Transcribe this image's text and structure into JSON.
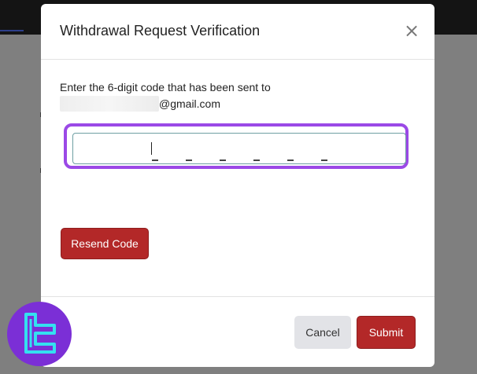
{
  "modal": {
    "title": "Withdrawal Request Verification",
    "close_label": "×",
    "instruction_text": "Enter the 6-digit code that has been sent to",
    "email_domain": "@gmail.com",
    "code_length": 6,
    "code_value": "",
    "resend_label": "Resend Code",
    "cancel_label": "Cancel",
    "submit_label": "Submit"
  },
  "colors": {
    "primary_red": "#b32828",
    "highlight_purple": "#9b49e6",
    "cancel_gray": "#e2e3e7",
    "watermark_purple": "#7b2fd6",
    "watermark_cyan": "#34e0f0"
  },
  "icons": {
    "close": "close-icon",
    "watermark_logo": "brand-logo-icon"
  }
}
